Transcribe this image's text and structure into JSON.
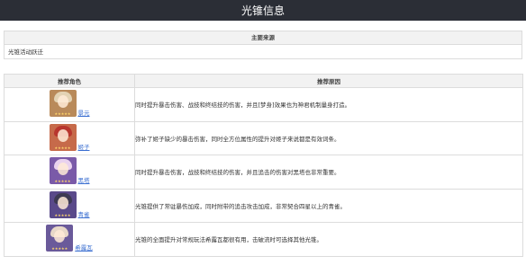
{
  "title": "光锥信息",
  "main_source": {
    "header": "主要来源",
    "value": "光锥活动跃迁"
  },
  "recommend": {
    "col_role": "推荐角色",
    "col_reason": "推荐原因",
    "rows": [
      {
        "name": "景元",
        "reason": "同时提升暴击伤害、战技和终结技的伤害，并且[梦身]效果也为神君机制量身打造。",
        "bg": "#b98a5a",
        "hair": "#e3d3b4"
      },
      {
        "name": "姬子",
        "reason": "弥补了姬子缺少的暴击伤害，同时全方位属性的提升对姬子来说都是有效词条。",
        "bg": "#c66a4a",
        "hair": "#b8362e"
      },
      {
        "name": "黑塔",
        "reason": "同时提升暴击伤害，战技和终结技的伤害，并且追击的伤害对黑塔也非常重要。",
        "bg": "#7a5aa8",
        "hair": "#e9d2ef"
      },
      {
        "name": "青雀",
        "reason": "光锥提供了常驻暴伤加成，同时附带的追击攻击加成，非常契合四星以上的青雀。",
        "bg": "#5a4a8a",
        "hair": "#3d3a52"
      },
      {
        "name": "希露瓦",
        "reason": "光锥的全面提升对常规玩法希露瓦都很有用，击破流时可选择其他光锥。",
        "bg": "#6a5a9a",
        "hair": "#e8d8c8"
      }
    ]
  }
}
